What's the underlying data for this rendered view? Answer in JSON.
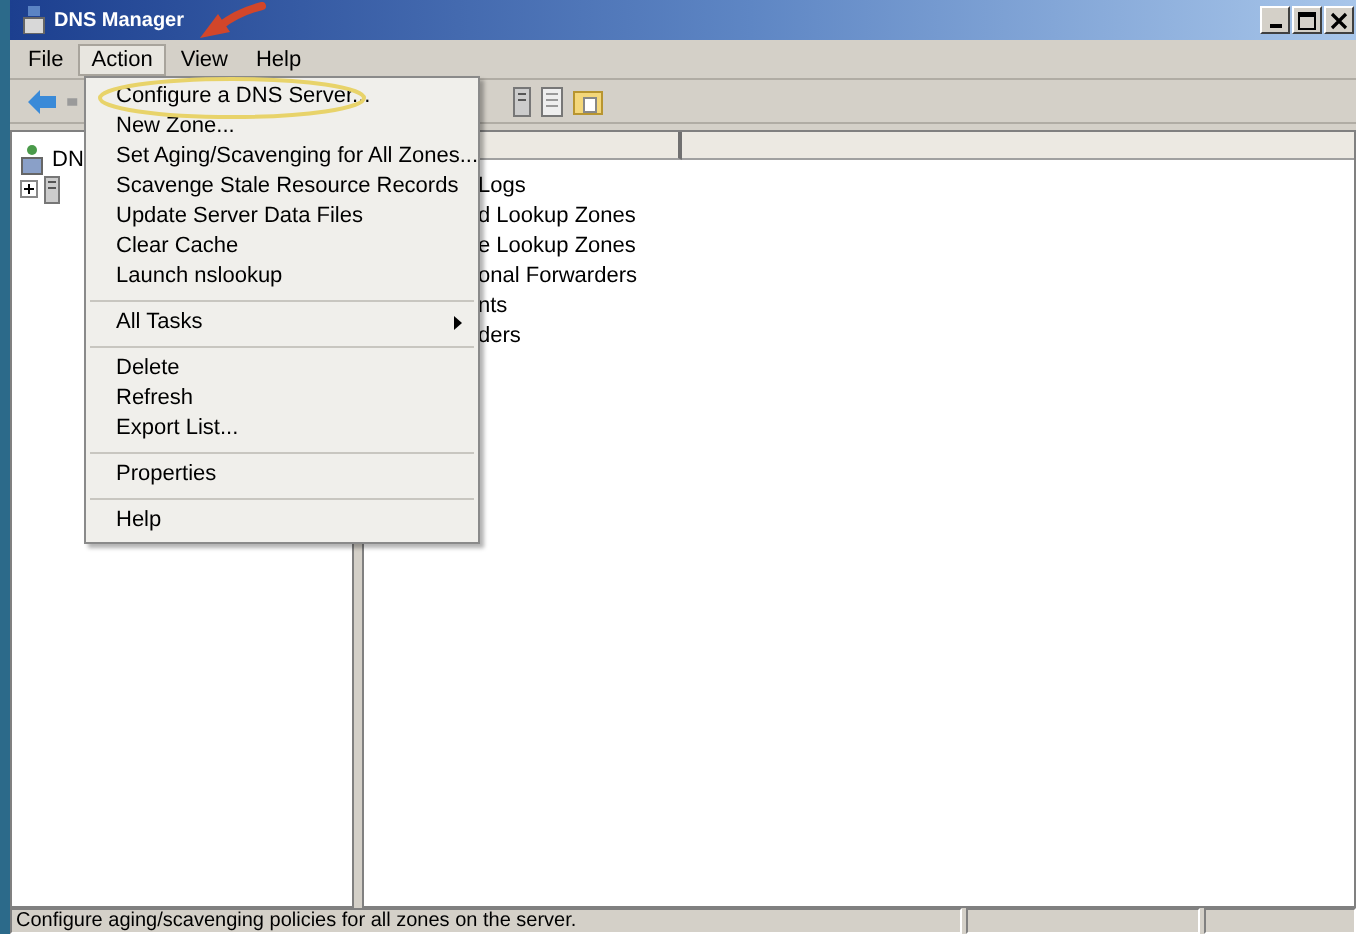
{
  "window": {
    "title": "DNS Manager"
  },
  "menu_bar": [
    {
      "label": "File",
      "selected": false
    },
    {
      "label": "Action",
      "selected": true
    },
    {
      "label": "View",
      "selected": false
    },
    {
      "label": "Help",
      "selected": false
    }
  ],
  "action_menu": [
    {
      "kind": "item",
      "label": "Configure a DNS Server...",
      "highlighted": true
    },
    {
      "kind": "item",
      "label": "New Zone..."
    },
    {
      "kind": "item",
      "label": "Set Aging/Scavenging for All Zones..."
    },
    {
      "kind": "item",
      "label": "Scavenge Stale Resource Records"
    },
    {
      "kind": "item",
      "label": "Update Server Data Files"
    },
    {
      "kind": "item",
      "label": "Clear Cache"
    },
    {
      "kind": "item",
      "label": "Launch nslookup"
    },
    {
      "kind": "separator"
    },
    {
      "kind": "submenu",
      "label": "All Tasks"
    },
    {
      "kind": "separator"
    },
    {
      "kind": "item",
      "label": "Delete"
    },
    {
      "kind": "item",
      "label": "Refresh"
    },
    {
      "kind": "item",
      "label": "Export List..."
    },
    {
      "kind": "separator"
    },
    {
      "kind": "item",
      "label": "Properties"
    },
    {
      "kind": "separator"
    },
    {
      "kind": "item",
      "label": "Help"
    }
  ],
  "tree": [
    {
      "label": "DN",
      "expanded": true,
      "children": [
        {
          "expanded": false
        }
      ]
    }
  ],
  "list_items": [
    "Logs",
    "d Lookup Zones",
    "e Lookup Zones",
    "onal Forwarders",
    "nts",
    "ders"
  ],
  "status_bar": {
    "text": "Configure aging/scavenging policies for all zones on the server."
  }
}
